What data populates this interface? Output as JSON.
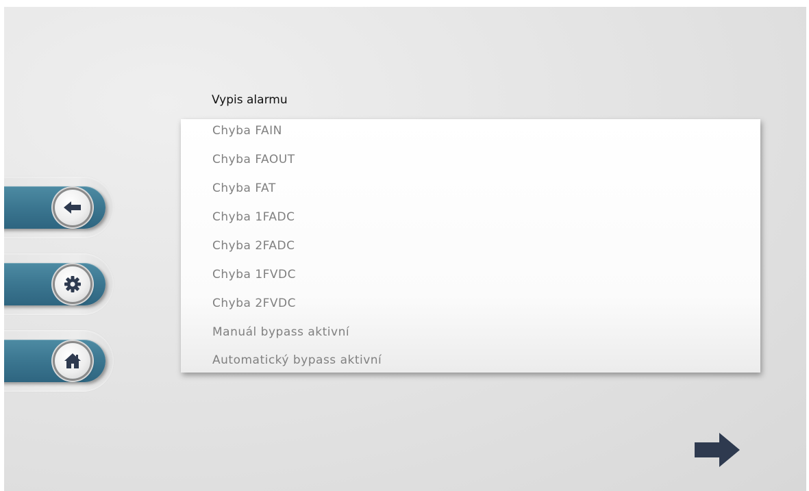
{
  "screen": {
    "title": "Vypis alarmu"
  },
  "alarms": [
    "Chyba FAIN",
    "Chyba FAOUT",
    "Chyba FAT",
    "Chyba 1FADC",
    "Chyba 2FADC",
    "Chyba 1FVDC",
    "Chyba 2FVDC",
    "Manuál bypass aktivní",
    "Automatický bypass aktivní"
  ],
  "navigation": {
    "buttons": [
      {
        "name": "back",
        "icon": "arrow-left-icon"
      },
      {
        "name": "settings",
        "icon": "gear-icon"
      },
      {
        "name": "home",
        "icon": "home-icon"
      }
    ],
    "next_icon": "arrow-right-icon"
  },
  "colors": {
    "tab_blue": "#3b7690",
    "icon_dark": "#2e3a4f",
    "alarm_text": "#808080",
    "title_text": "#111111"
  }
}
